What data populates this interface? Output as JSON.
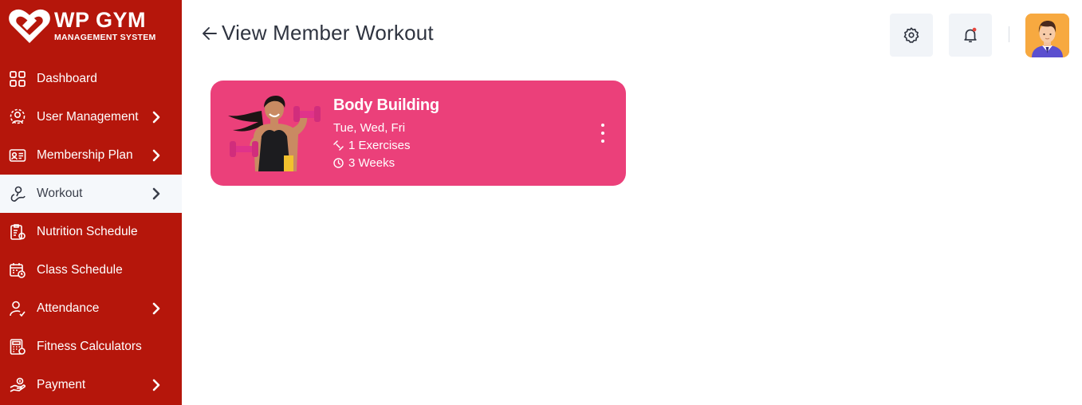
{
  "brand": {
    "title": "WP GYM",
    "subtitle": "MANAGEMENT SYSTEM",
    "color": "#b5160b"
  },
  "sidebar": {
    "items": [
      {
        "label": "Dashboard",
        "icon": "dashboard-grid-icon",
        "has_submenu": false,
        "active": false
      },
      {
        "label": "User Management",
        "icon": "users-gear-icon",
        "has_submenu": true,
        "active": false
      },
      {
        "label": "Membership Plan",
        "icon": "membership-card-icon",
        "has_submenu": true,
        "active": false
      },
      {
        "label": "Workout",
        "icon": "workout-icon",
        "has_submenu": true,
        "active": true
      },
      {
        "label": "Nutrition Schedule",
        "icon": "nutrition-clipboard-icon",
        "has_submenu": false,
        "active": false
      },
      {
        "label": "Class Schedule",
        "icon": "calendar-clock-icon",
        "has_submenu": false,
        "active": false
      },
      {
        "label": "Attendance",
        "icon": "user-check-icon",
        "has_submenu": true,
        "active": false
      },
      {
        "label": "Fitness Calculators",
        "icon": "calculator-icon",
        "has_submenu": false,
        "active": false
      },
      {
        "label": "Payment",
        "icon": "payment-hand-icon",
        "has_submenu": true,
        "active": false
      }
    ]
  },
  "header": {
    "title": "View Member Workout",
    "back_icon": "arrow-left-icon",
    "settings_icon": "gear-icon",
    "notification_icon": "bell-icon",
    "notification_dot_color": "#e8453c",
    "avatar_icon": "user-avatar-icon"
  },
  "workout_card": {
    "title": "Body Building",
    "days": "Tue, Wed, Fri",
    "exercises": "1 Exercises",
    "duration": "3 Weeks",
    "background": "#eb407a",
    "menu_icon": "more-vertical-icon"
  }
}
